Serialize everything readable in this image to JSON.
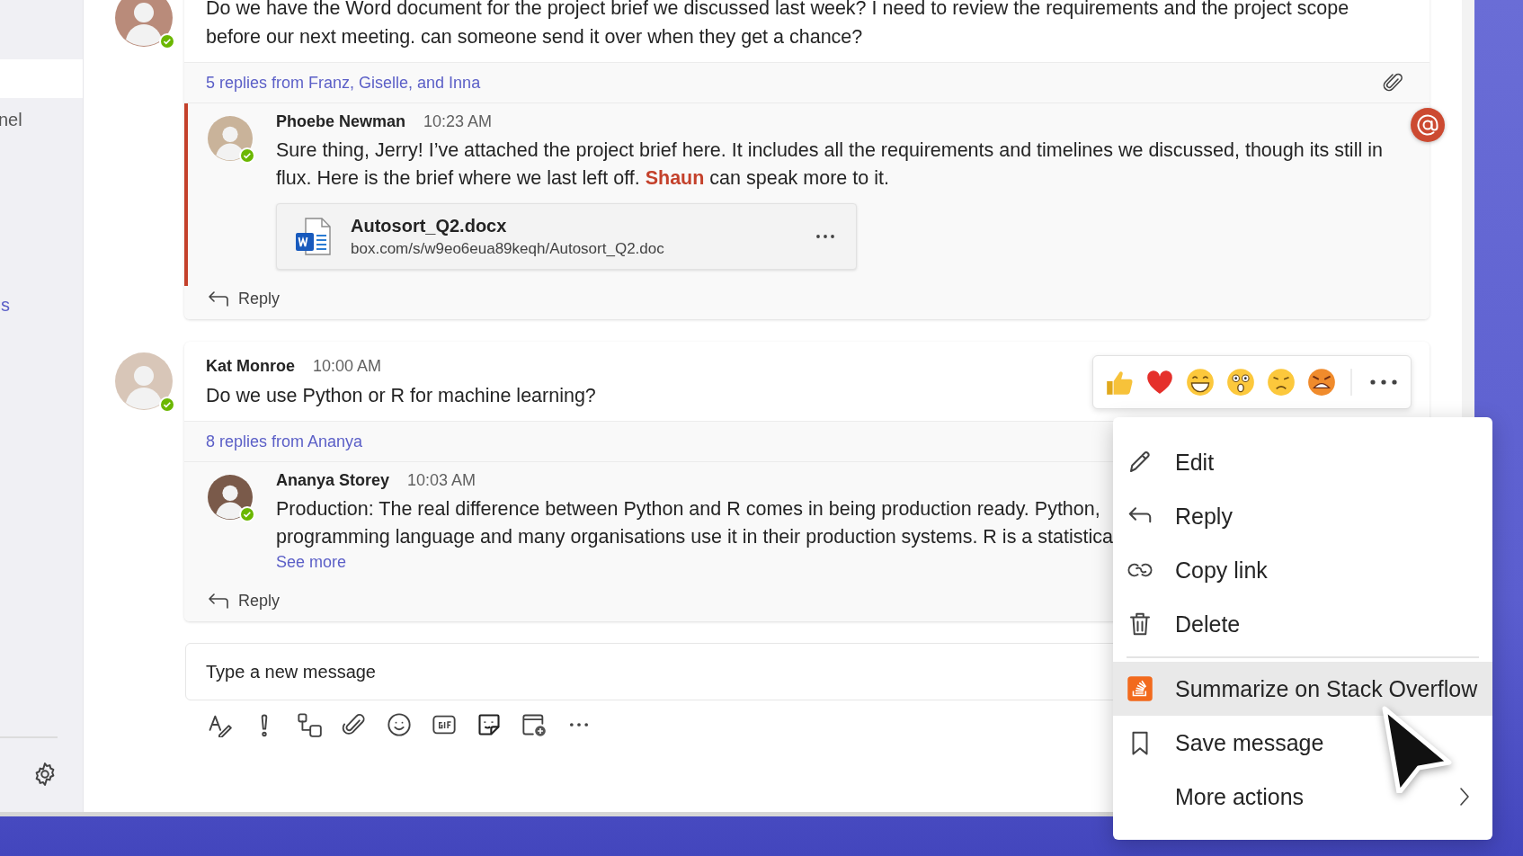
{
  "sidebar": {
    "items": [
      {
        "label": "nel",
        "kind": "channel"
      },
      {
        "label": "s",
        "kind": "link"
      }
    ]
  },
  "threads": [
    {
      "mentioned": true,
      "text_lines": [
        "Do we have the Word document for the project brief we discussed last week? I need to review the requirements and the project scope",
        "before our next meeting. can someone send it over when they get a chance?"
      ],
      "replies_summary": "5 replies from Franz, Giselle, and Inna",
      "has_attachment": true,
      "replies": [
        {
          "author": "Phoebe Newman",
          "time": "10:23 AM",
          "text_lines": [
            "Sure thing, Jerry! I’ve attached the project brief here. It includes all the requirements and timelines we discussed, though its still in",
            "flux. Here is the brief where we last left off. **Shaun** can speak more to it."
          ],
          "file": {
            "name": "Autosort_Q2.docx",
            "url": "box.com/s/w9eo6eua89keqh/Autosort_Q2.doc"
          }
        }
      ],
      "reply_action": "Reply"
    },
    {
      "author": "Kat Monroe",
      "time": "10:00 AM",
      "mentioned": false,
      "text_lines": [
        "Do we use Python or R for machine learning?"
      ],
      "replies_summary": "8 replies from Ananya",
      "replies": [
        {
          "author": "Ananya Storey",
          "time": "10:03 AM",
          "text_lines": [
            "Production: The real difference between Python and R comes in being production ready. Python,",
            "programming language and many organisations use it in their production systems. R is a statistica"
          ],
          "see_more": "See more"
        }
      ],
      "reply_action": "Reply"
    }
  ],
  "composer": {
    "placeholder": "Type a new message"
  },
  "context_menu": {
    "items": [
      {
        "label": "Edit",
        "kind": "edit",
        "selected": false
      },
      {
        "label": "Reply",
        "kind": "reply",
        "selected": false
      },
      {
        "label": "Copy link",
        "kind": "copy-link",
        "selected": false
      },
      {
        "label": "Delete",
        "kind": "delete",
        "selected": false
      },
      {
        "kind": "separator"
      },
      {
        "label": "Summarize on Stack Overflow",
        "kind": "app",
        "selected": true
      },
      {
        "label": "Save message",
        "kind": "save",
        "selected": false
      },
      {
        "label": "More actions",
        "kind": "submenu",
        "selected": false
      }
    ]
  }
}
